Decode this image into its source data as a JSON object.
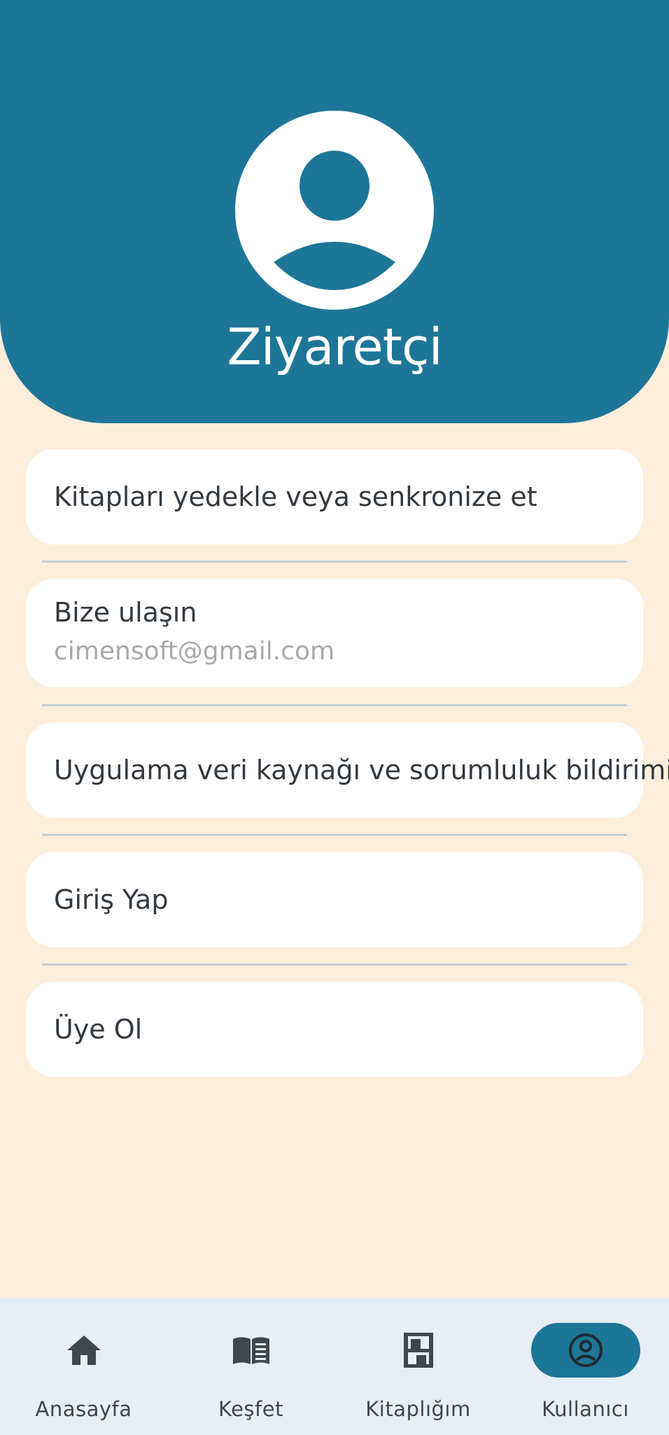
{
  "profile": {
    "name": "Ziyaretçi"
  },
  "menu": {
    "backup": "Kitapları yedekle veya senkronize et",
    "contact_title": "Bize ulaşın",
    "contact_email": "cimensoft@gmail.com",
    "disclaimer": "Uygulama veri kaynağı ve sorumluluk bildirimi",
    "login": "Giriş Yap",
    "signup": "Üye Ol"
  },
  "nav": {
    "home": "Anasayfa",
    "explore": "Keşfet",
    "library": "Kitaplığım",
    "user": "Kullanıcı",
    "active": "user"
  },
  "colors": {
    "primary": "#1D7697",
    "background": "#FDEEDC",
    "card": "#FFFFFF",
    "nav_background": "#E7EEF5",
    "text": "#333A40",
    "muted_text": "#A8A8A8"
  },
  "icons": {
    "avatar": "user-avatar-icon",
    "home": "home-icon",
    "explore": "open-book-icon",
    "library": "bookshelf-icon",
    "user": "account-circle-icon"
  }
}
